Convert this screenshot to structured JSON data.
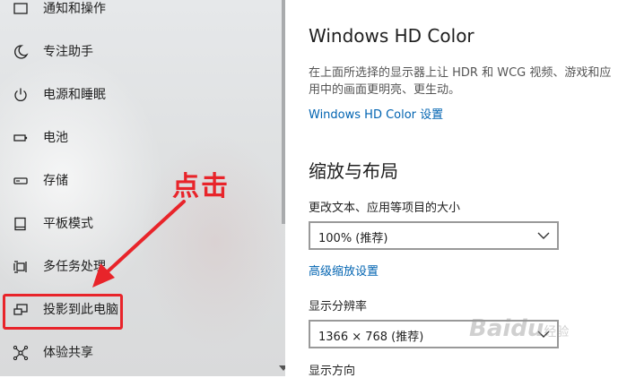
{
  "sidebar": {
    "items": [
      {
        "label": "通知和操作",
        "icon": "notification-icon"
      },
      {
        "label": "专注助手",
        "icon": "moon-icon"
      },
      {
        "label": "电源和睡眠",
        "icon": "power-icon"
      },
      {
        "label": "电池",
        "icon": "battery-icon"
      },
      {
        "label": "存储",
        "icon": "storage-icon"
      },
      {
        "label": "平板模式",
        "icon": "tablet-icon"
      },
      {
        "label": "多任务处理",
        "icon": "multitask-icon"
      },
      {
        "label": "投影到此电脑",
        "icon": "project-icon"
      },
      {
        "label": "体验共享",
        "icon": "share-icon"
      }
    ]
  },
  "annotation": {
    "text": "点击",
    "color": "#e8242a"
  },
  "main": {
    "hdr_title": "Windows HD Color",
    "hdr_desc": "在上面所选择的显示器上让 HDR 和 WCG 视频、游戏和应用中的画面更明亮、更生动。",
    "hdr_link": "Windows HD Color 设置",
    "scale_title": "缩放与布局",
    "scale_label": "更改文本、应用等项目的大小",
    "scale_value": "100% (推荐)",
    "advanced_link": "高级缩放设置",
    "resolution_label": "显示分辨率",
    "resolution_value": "1366 × 768 (推荐)",
    "orientation_label": "显示方向"
  },
  "colors": {
    "link": "#0063b1",
    "annotation": "#e8242a",
    "sidebar_bg": "#e0e2e3"
  },
  "watermark": {
    "main": "Baidu",
    "sub": "经验"
  }
}
